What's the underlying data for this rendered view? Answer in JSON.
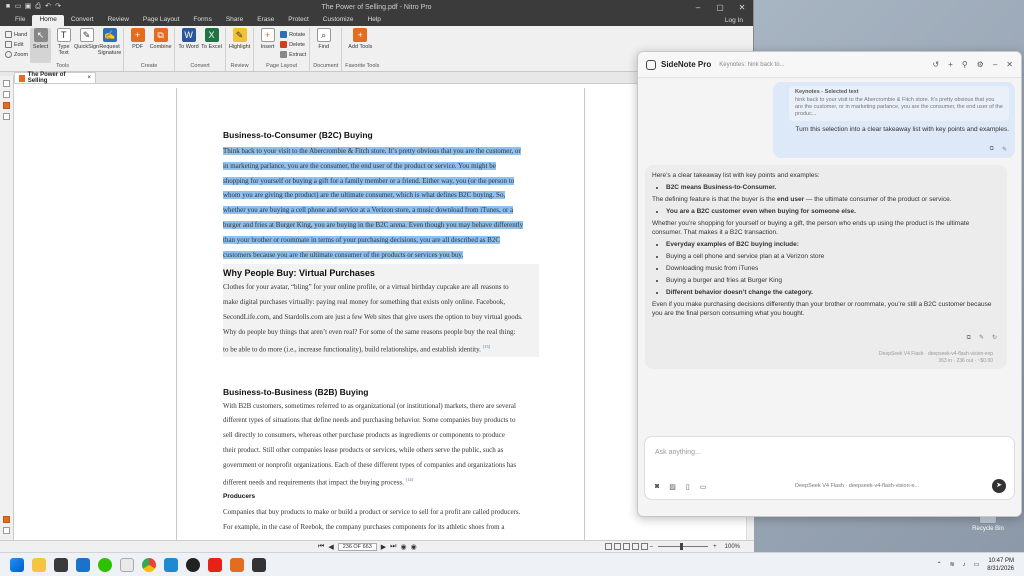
{
  "window": {
    "title": "The Power of Selling.pdf - Nitro Pro"
  },
  "menu": {
    "tabs": [
      "File",
      "Home",
      "Convert",
      "Review",
      "Page Layout",
      "Forms",
      "Share",
      "Erase",
      "Protect",
      "Customize",
      "Help"
    ],
    "active": "Home",
    "login": "Log In"
  },
  "ribbon": {
    "tools": {
      "hand": "Hand",
      "edit": "Edit",
      "zoom": "Zoom",
      "select": "Select",
      "type_text": "Type Text",
      "quicksign": "QuickSign",
      "request_signature": "Request Signature",
      "label": "Tools"
    },
    "create": {
      "pdf": "PDF",
      "combine": "Combine",
      "label": "Create"
    },
    "convert": {
      "to_word": "To Word",
      "to_excel": "To Excel",
      "label": "Convert"
    },
    "review": {
      "highlight": "Highlight",
      "label": "Review"
    },
    "page_layout": {
      "insert": "Insert",
      "rotate": "Rotate",
      "delete": "Delete",
      "extract": "Extract",
      "label": "Page Layout"
    },
    "document": {
      "find": "Find",
      "label": "Document"
    },
    "favorite": {
      "add_tools": "Add Tools",
      "label": "Favorite Tools"
    }
  },
  "doc_tab": {
    "name": "The Power of Selling"
  },
  "document": {
    "h1": "Business-to-Consumer (B2C) Buying",
    "hl_lines": [
      "Think back to your visit to the Abercrombie & Fitch store. It’s pretty obvious that you are the customer, or",
      "in marketing parlance, you are the consumer, the end user of the product or service. You might be",
      "shopping for yourself or buying a gift for a family member or a friend. Either way, you (or the person to",
      "whom you are giving the product) are the ultimate consumer, which is what defines B2C buying. So,",
      "whether you are buying a cell phone and service at a Verizon store, a music download from iTunes, or a",
      "burger and fries at Burger King, you are buying in the B2C arena. Even though you may behave differently",
      "than your brother or roommate in terms of your purchasing decisions, you are all described as B2C",
      "customers because you are the ultimate consumer of the products or services you buy."
    ],
    "h2": "Why People Buy: Virtual Purchases",
    "p2_lines": [
      "Clothes for your avatar, “bling” for your online profile, or a virtual birthday cupcake are all reasons to",
      "make digital purchases virtually: paying real money for something that exists only online. Facebook,",
      "SecondLife.com, and Stardolls.com are just a few Web sites that give users the option to buy virtual goods.",
      "Why do people buy things that aren’t even real? For some of the same reasons people buy the real thing:",
      "to be able to do more (i.e., increase functionality), build relationships, and establish identity."
    ],
    "ref1": "[13]",
    "h3": "Business-to-Business (B2B) Buying",
    "p3_lines": [
      "With B2B customers, sometimes referred to as organizational (or institutional) markets, there are several",
      "different types of situations that define needs and purchasing behavior. Some companies buy products to",
      "sell directly to consumers, whereas other purchase products as ingredients or components to produce",
      "their product. Still other companies lease products or services, while others serve the public, such as",
      "government or nonprofit organizations. Each of these different types of companies and organizations has",
      "different needs and requirements that impact the buying process."
    ],
    "ref2": "[14]",
    "h4": "Producers",
    "p4_lines": [
      "Companies that buy products to make or build a product or service to sell for a profit are called producers.",
      "For example, in the case of Reebok, the company purchases components for its athletic shoes from a"
    ]
  },
  "status": {
    "page": "236 OF 663",
    "zoom": "100%"
  },
  "sidenote": {
    "title": "SideNote Pro",
    "subtitle": "Keynotes: hink back to...",
    "quote_title": "Keynotes - Selected text",
    "quote_text": "hink back to your visit to the Abercrombie & Fitch store. It's pretty obvious that you are the customer, or in marketing parlance, you are the consumer, the end user of the produc...",
    "user_message": "Turn this selection into a clear takeaway list with key points and examples.",
    "answer": {
      "intro": "Here’s a clear takeaway list with key points and examples:",
      "b1": "B2C means Business-to-Consumer.",
      "p1a": "The defining feature is that the buyer is the ",
      "p1b": "end user",
      "p1c": " — the ultimate consumer of the product or service.",
      "b2": "You are a B2C customer even when buying for someone else.",
      "p2": "Whether you’re shopping for yourself or buying a gift, the person who ends up using the product is the ultimate consumer. That makes it a B2C transaction.",
      "b3": "Everyday examples of B2C buying include:",
      "ex1": "Buying a cell phone and service plan at a Verizon store",
      "ex2": "Downloading music from iTunes",
      "ex3": "Buying a burger and fries at Burger King",
      "b4": "Different behavior doesn’t change the category.",
      "p4": "Even if you make purchasing decisions differently than your brother or roommate, you’re still a B2C customer because you are the final person consuming what you bought.",
      "meta1": "DeepSeek V4 Flash · deepseek-v4-flash-vision-exp",
      "meta2": "363 in · 236 out · ~$0.00"
    },
    "input_placeholder": "Ask anything...",
    "model_label": "DeepSeek V4 Flash · deepseek-v4-flash-vision-e..."
  },
  "desktop": {
    "recycle_bin": "Recycle Bin"
  },
  "taskbar": {
    "time": "10:47 PM",
    "date": "8/31/2026"
  },
  "icons": {
    "send": "send-icon",
    "recycle": "recycle-bin-icon"
  }
}
